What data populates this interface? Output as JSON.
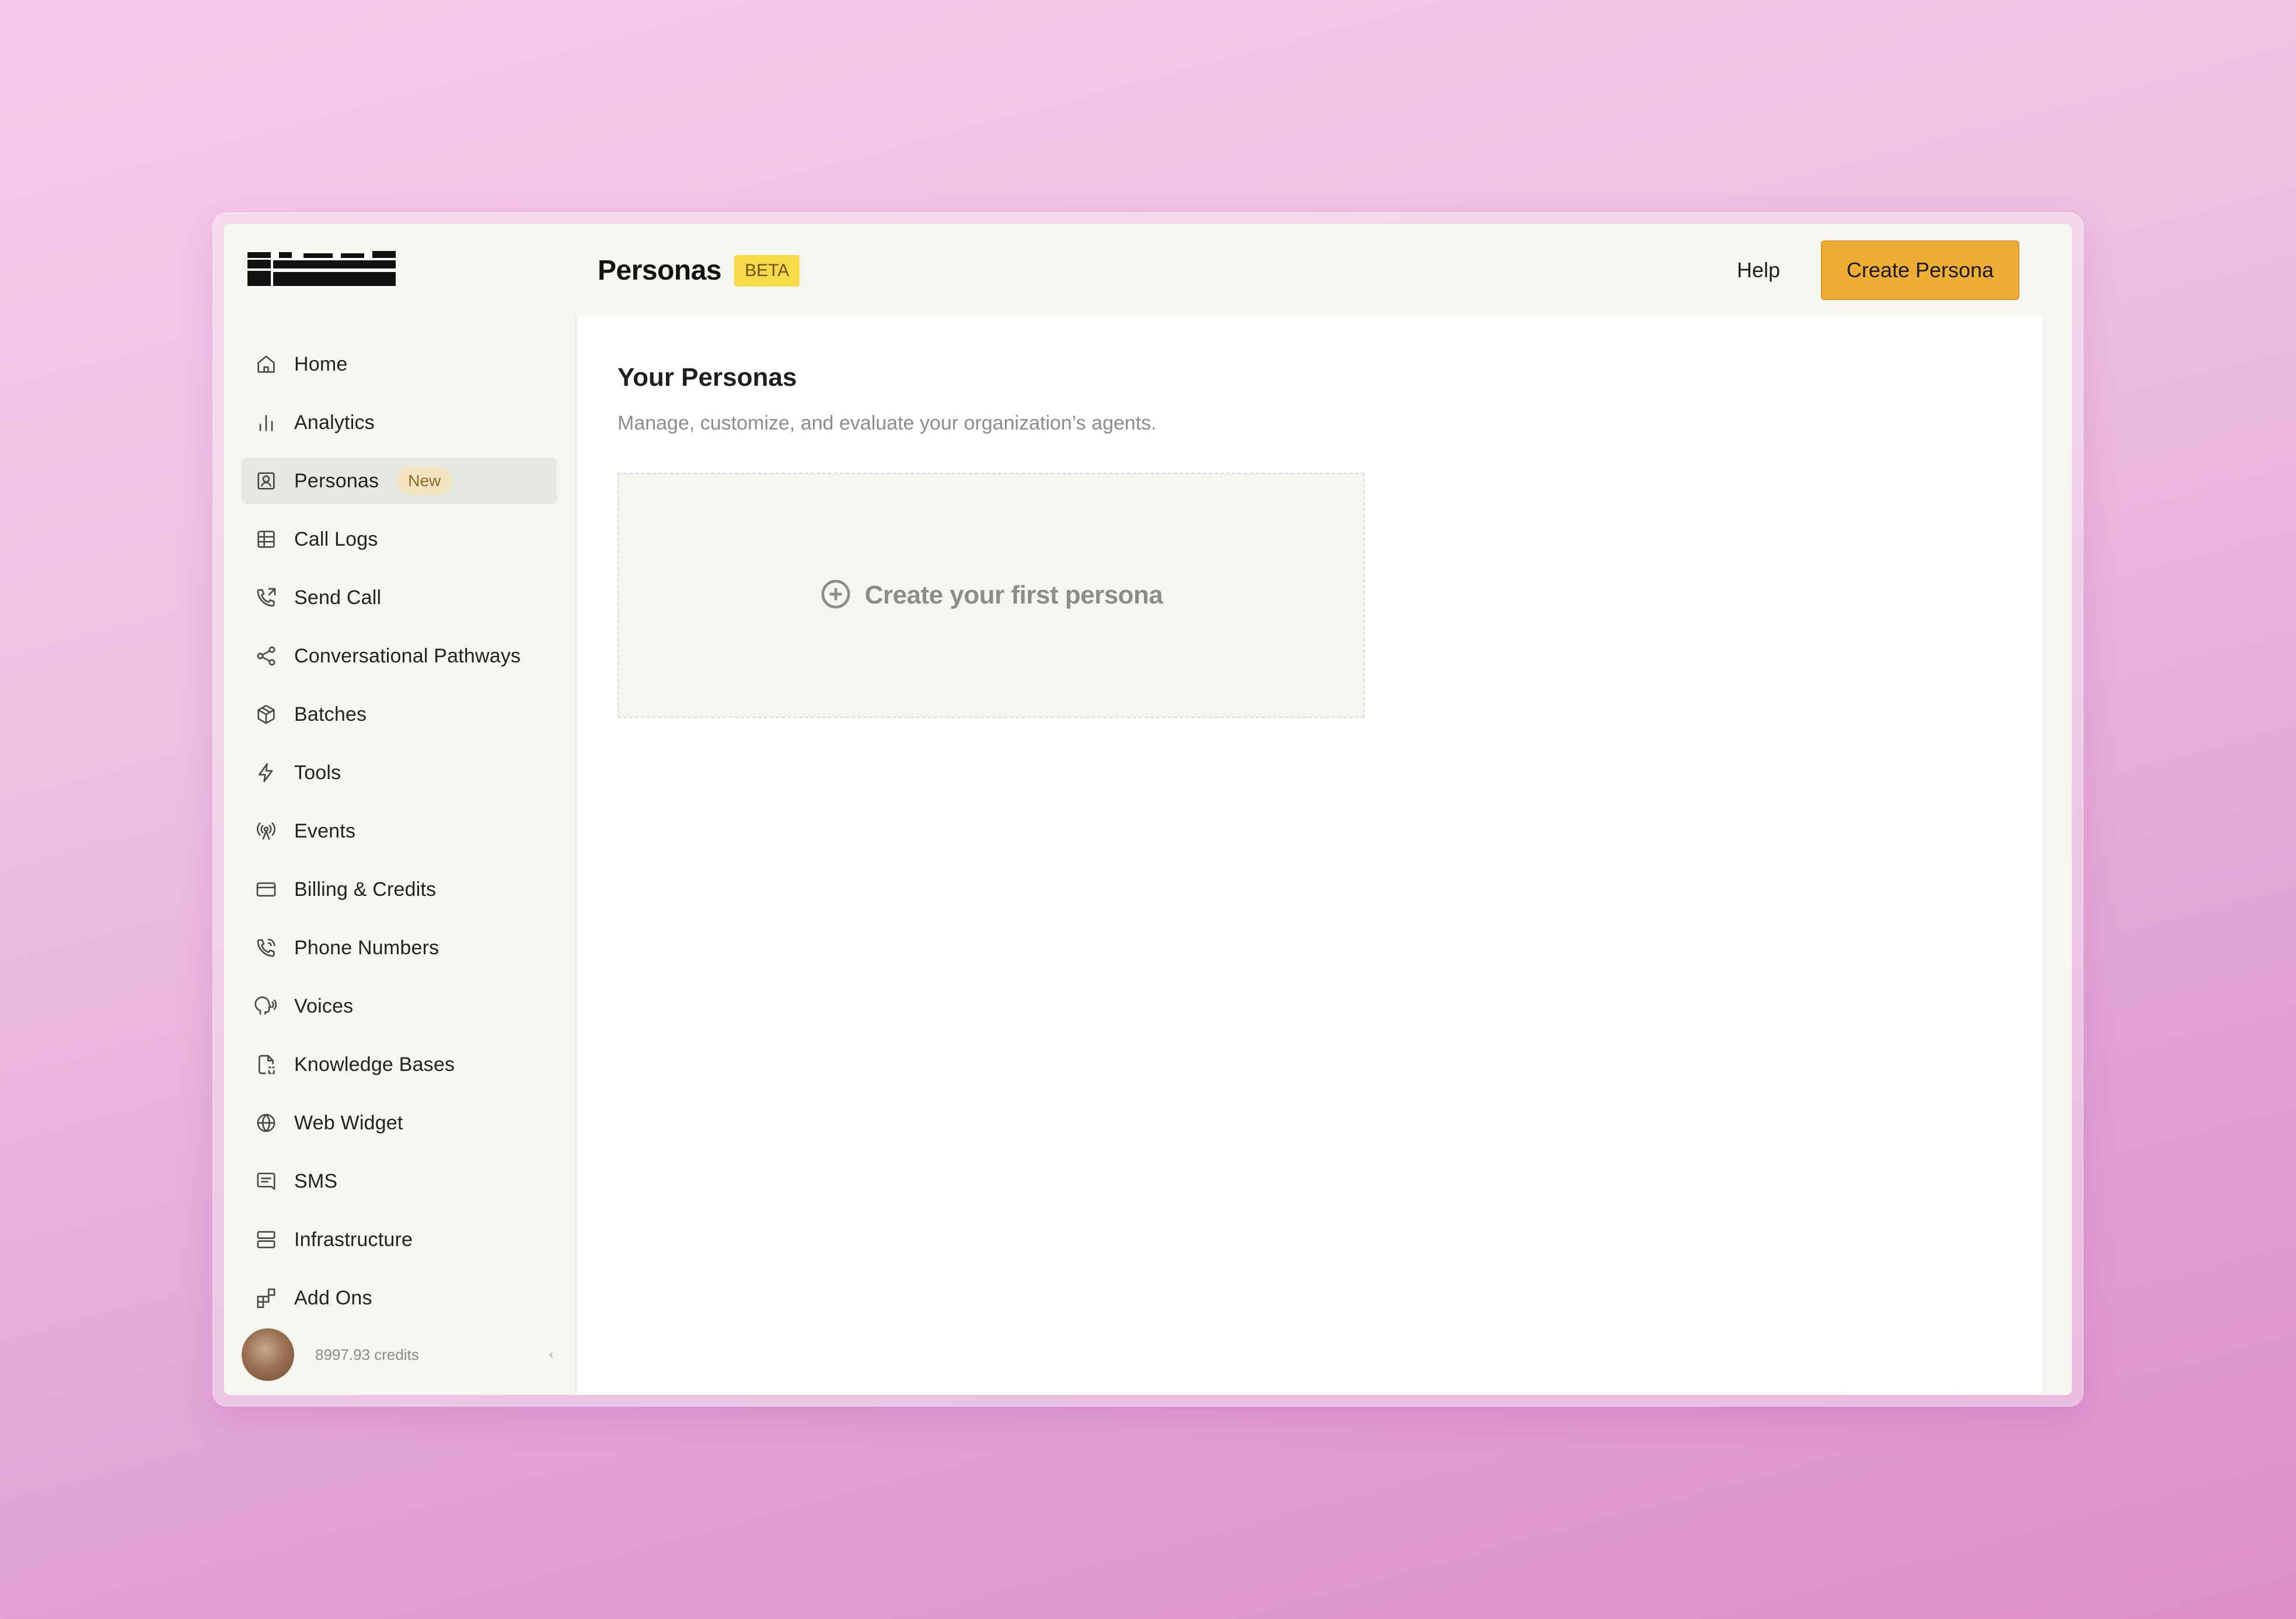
{
  "app": {
    "accent_color": "#efae33",
    "beta_color": "#f7d94a"
  },
  "sidebar": {
    "items": [
      {
        "label": "Home",
        "icon": "home-icon"
      },
      {
        "label": "Analytics",
        "icon": "bar-chart-icon"
      },
      {
        "label": "Personas",
        "icon": "persona-icon",
        "badge": "New",
        "active": true
      },
      {
        "label": "Call Logs",
        "icon": "table-icon"
      },
      {
        "label": "Send Call",
        "icon": "phone-outgoing-icon"
      },
      {
        "label": "Conversational Pathways",
        "icon": "share-nodes-icon"
      },
      {
        "label": "Batches",
        "icon": "package-icon"
      },
      {
        "label": "Tools",
        "icon": "lightning-icon"
      },
      {
        "label": "Events",
        "icon": "radio-tower-icon"
      },
      {
        "label": "Billing & Credits",
        "icon": "credit-card-icon"
      },
      {
        "label": "Phone Numbers",
        "icon": "phone-icon"
      },
      {
        "label": "Voices",
        "icon": "voice-head-icon"
      },
      {
        "label": "Knowledge Bases",
        "icon": "file-dashed-icon"
      },
      {
        "label": "Web Widget",
        "icon": "globe-icon"
      },
      {
        "label": "SMS",
        "icon": "message-icon"
      },
      {
        "label": "Infrastructure",
        "icon": "server-icon"
      },
      {
        "label": "Add Ons",
        "icon": "blocks-icon"
      }
    ],
    "user": {
      "credits": "8997.93 credits"
    }
  },
  "header": {
    "title": "Personas",
    "badge": "BETA",
    "help": "Help",
    "create_button": "Create Persona"
  },
  "main": {
    "section_title": "Your Personas",
    "section_subtitle": "Manage, customize, and evaluate your organization’s agents.",
    "empty_card_label": "Create your first persona"
  }
}
